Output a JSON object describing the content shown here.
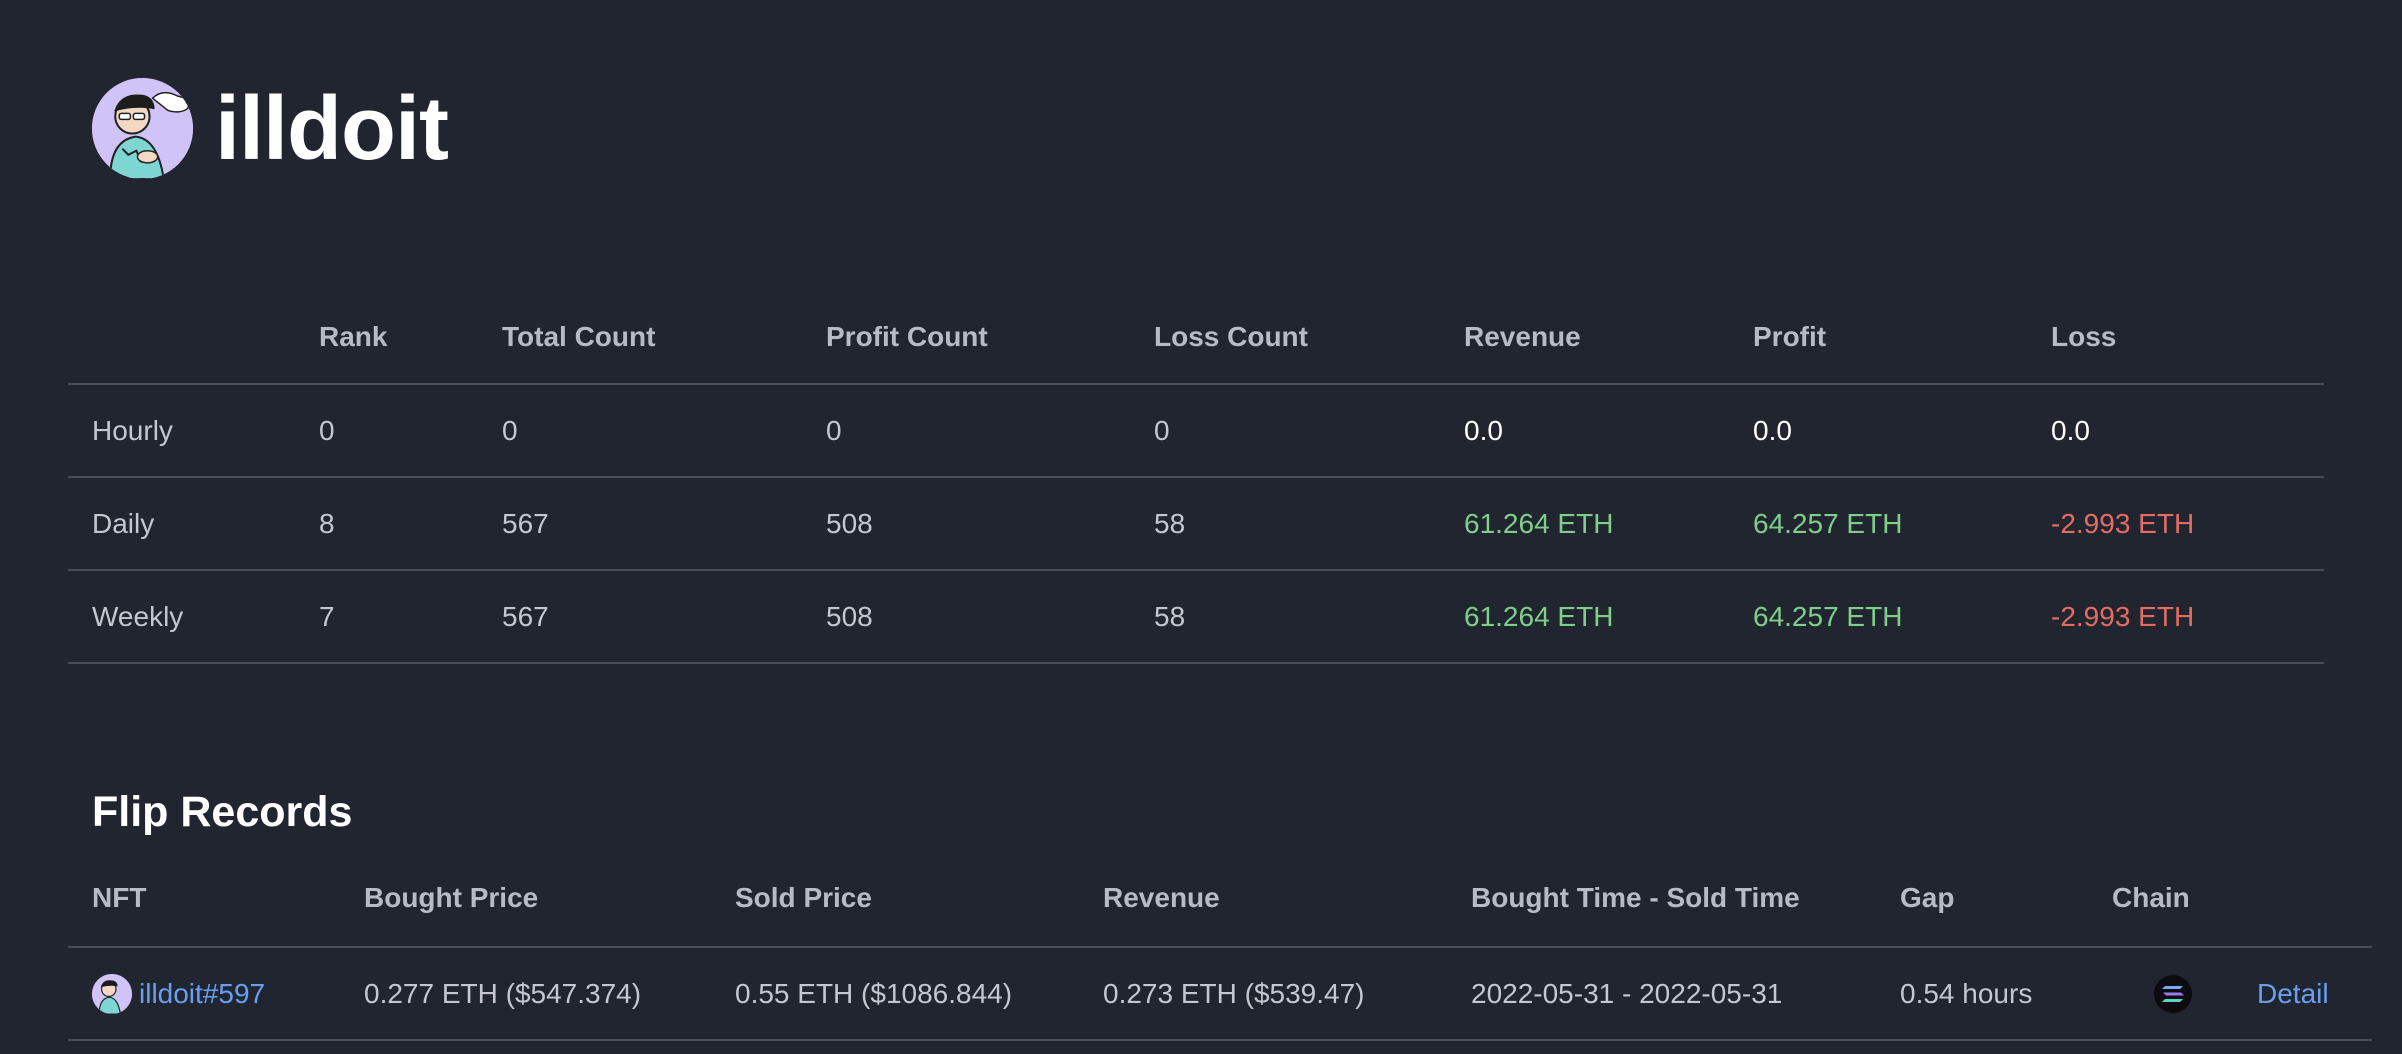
{
  "profile": {
    "name": "illdoit",
    "avatar_icon": "cartoon-avatar-icon"
  },
  "stats": {
    "columns": [
      "",
      "Rank",
      "Total Count",
      "Profit Count",
      "Loss Count",
      "Revenue",
      "Profit",
      "Loss"
    ],
    "rows": [
      {
        "label": "Hourly",
        "rank": "0",
        "total": "0",
        "profit_count": "0",
        "loss_count": "0",
        "revenue": "0.0",
        "profit": "0.0",
        "loss": "0.0"
      },
      {
        "label": "Daily",
        "rank": "8",
        "total": "567",
        "profit_count": "508",
        "loss_count": "58",
        "revenue": "61.264 ETH",
        "profit": "64.257 ETH",
        "loss": "-2.993 ETH"
      },
      {
        "label": "Weekly",
        "rank": "7",
        "total": "567",
        "profit_count": "508",
        "loss_count": "58",
        "revenue": "61.264 ETH",
        "profit": "64.257 ETH",
        "loss": "-2.993 ETH"
      }
    ]
  },
  "flip_records": {
    "title": "Flip Records",
    "columns": [
      "NFT",
      "Bought Price",
      "Sold Price",
      "Revenue",
      "Bought Time - Sold Time",
      "Gap",
      "Chain"
    ],
    "rows": [
      {
        "nft": "illdoit#597",
        "bought_price": "0.277 ETH ($547.374)",
        "sold_price": "0.55 ETH ($1086.844)",
        "revenue": "0.273 ETH ($539.47)",
        "time_range": "2022-05-31 - 2022-05-31",
        "gap": "0.54 hours",
        "chain_icon": "chain-logo-icon",
        "detail_label": "Detail"
      }
    ]
  },
  "colors": {
    "background": "#212530",
    "positive": "#7fcf8a",
    "negative": "#e36c63",
    "link": "#6a9ff0"
  }
}
